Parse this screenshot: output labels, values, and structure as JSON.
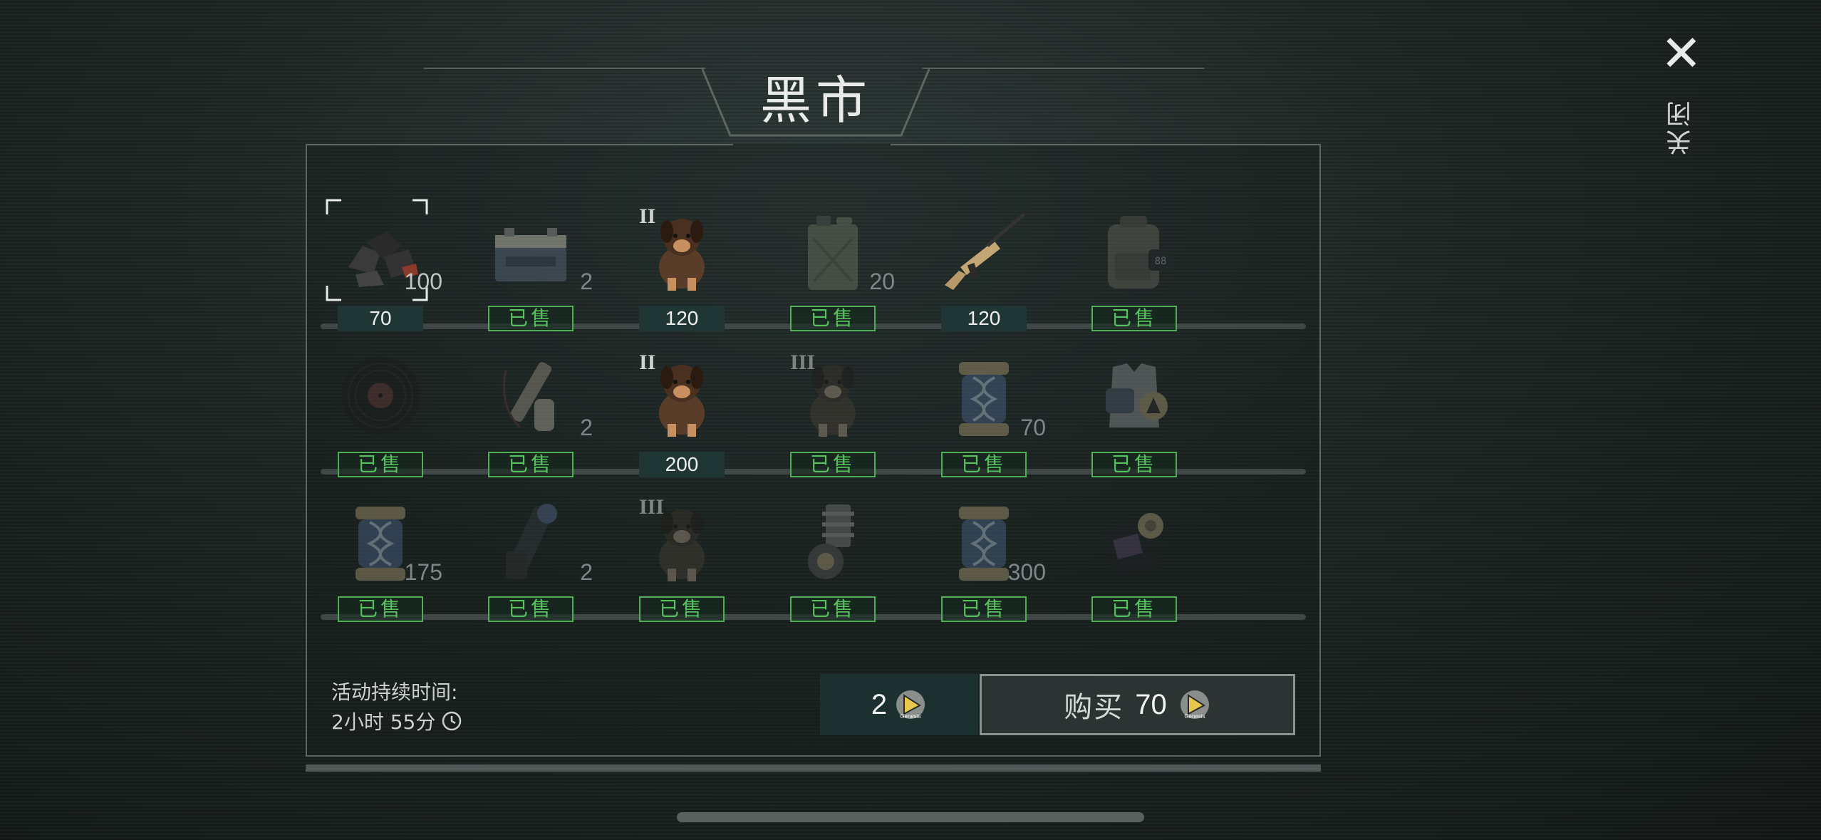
{
  "header": {
    "title": "黑市"
  },
  "close": {
    "label": "关闭",
    "icon": "close-icon"
  },
  "sold_label": "已售",
  "rows": [
    [
      {
        "id": "coal",
        "icon": "coal-icon",
        "qty": "100",
        "tier": "",
        "price": "70",
        "sold": false,
        "selected": true
      },
      {
        "id": "battery",
        "icon": "battery-icon",
        "qty": "2",
        "tier": "",
        "price": "",
        "sold": true
      },
      {
        "id": "puppy-shepherd",
        "icon": "puppy-icon",
        "qty": "",
        "tier": "II",
        "price": "120",
        "sold": false
      },
      {
        "id": "jerrycan",
        "icon": "jerrycan-icon",
        "qty": "20",
        "tier": "",
        "price": "",
        "sold": true
      },
      {
        "id": "rifle",
        "icon": "rifle-icon",
        "qty": "",
        "tier": "",
        "price": "120",
        "sold": false
      },
      {
        "id": "backpack",
        "icon": "backpack-icon",
        "qty": "",
        "tier": "",
        "price": "",
        "sold": true
      }
    ],
    [
      {
        "id": "vinyl",
        "icon": "vinyl-record-icon",
        "qty": "",
        "tier": "",
        "price": "",
        "sold": true
      },
      {
        "id": "parts",
        "icon": "scope-parts-icon",
        "qty": "2",
        "tier": "",
        "price": "",
        "sold": true
      },
      {
        "id": "puppy-stbernard",
        "icon": "puppy-icon",
        "qty": "",
        "tier": "II",
        "price": "200",
        "sold": false
      },
      {
        "id": "puppy-shepherd-3",
        "icon": "puppy-icon",
        "qty": "",
        "tier": "III",
        "price": "",
        "sold": true
      },
      {
        "id": "dna-70",
        "icon": "dna-capsule-icon",
        "qty": "70",
        "tier": "",
        "price": "",
        "sold": true
      },
      {
        "id": "vest",
        "icon": "armor-vest-icon",
        "qty": "",
        "tier": "",
        "price": "",
        "sold": true
      }
    ],
    [
      {
        "id": "dna-175",
        "icon": "dna-capsule-icon",
        "qty": "175",
        "tier": "",
        "price": "",
        "sold": true
      },
      {
        "id": "scope",
        "icon": "scope-icon",
        "qty": "2",
        "tier": "",
        "price": "",
        "sold": true
      },
      {
        "id": "puppy-rottweiler",
        "icon": "puppy-icon",
        "qty": "",
        "tier": "III",
        "price": "",
        "sold": true
      },
      {
        "id": "engine-part",
        "icon": "engine-part-icon",
        "qty": "",
        "tier": "",
        "price": "",
        "sold": true
      },
      {
        "id": "dna-300",
        "icon": "dna-capsule-icon",
        "qty": "300",
        "tier": "",
        "price": "",
        "sold": true
      },
      {
        "id": "badge",
        "icon": "police-badge-icon",
        "qty": "",
        "tier": "",
        "price": "",
        "sold": true
      }
    ]
  ],
  "footer": {
    "duration_label": "活动持续时间:",
    "duration_value": "2小时 55分",
    "balance": "2",
    "buy_label": "购买",
    "buy_price": "70",
    "currency_icon": "genesis-coin-icon",
    "currency_text": "Genesis"
  },
  "colors": {
    "sold_green": "#56c25e",
    "price_bg": "#1f3634"
  }
}
